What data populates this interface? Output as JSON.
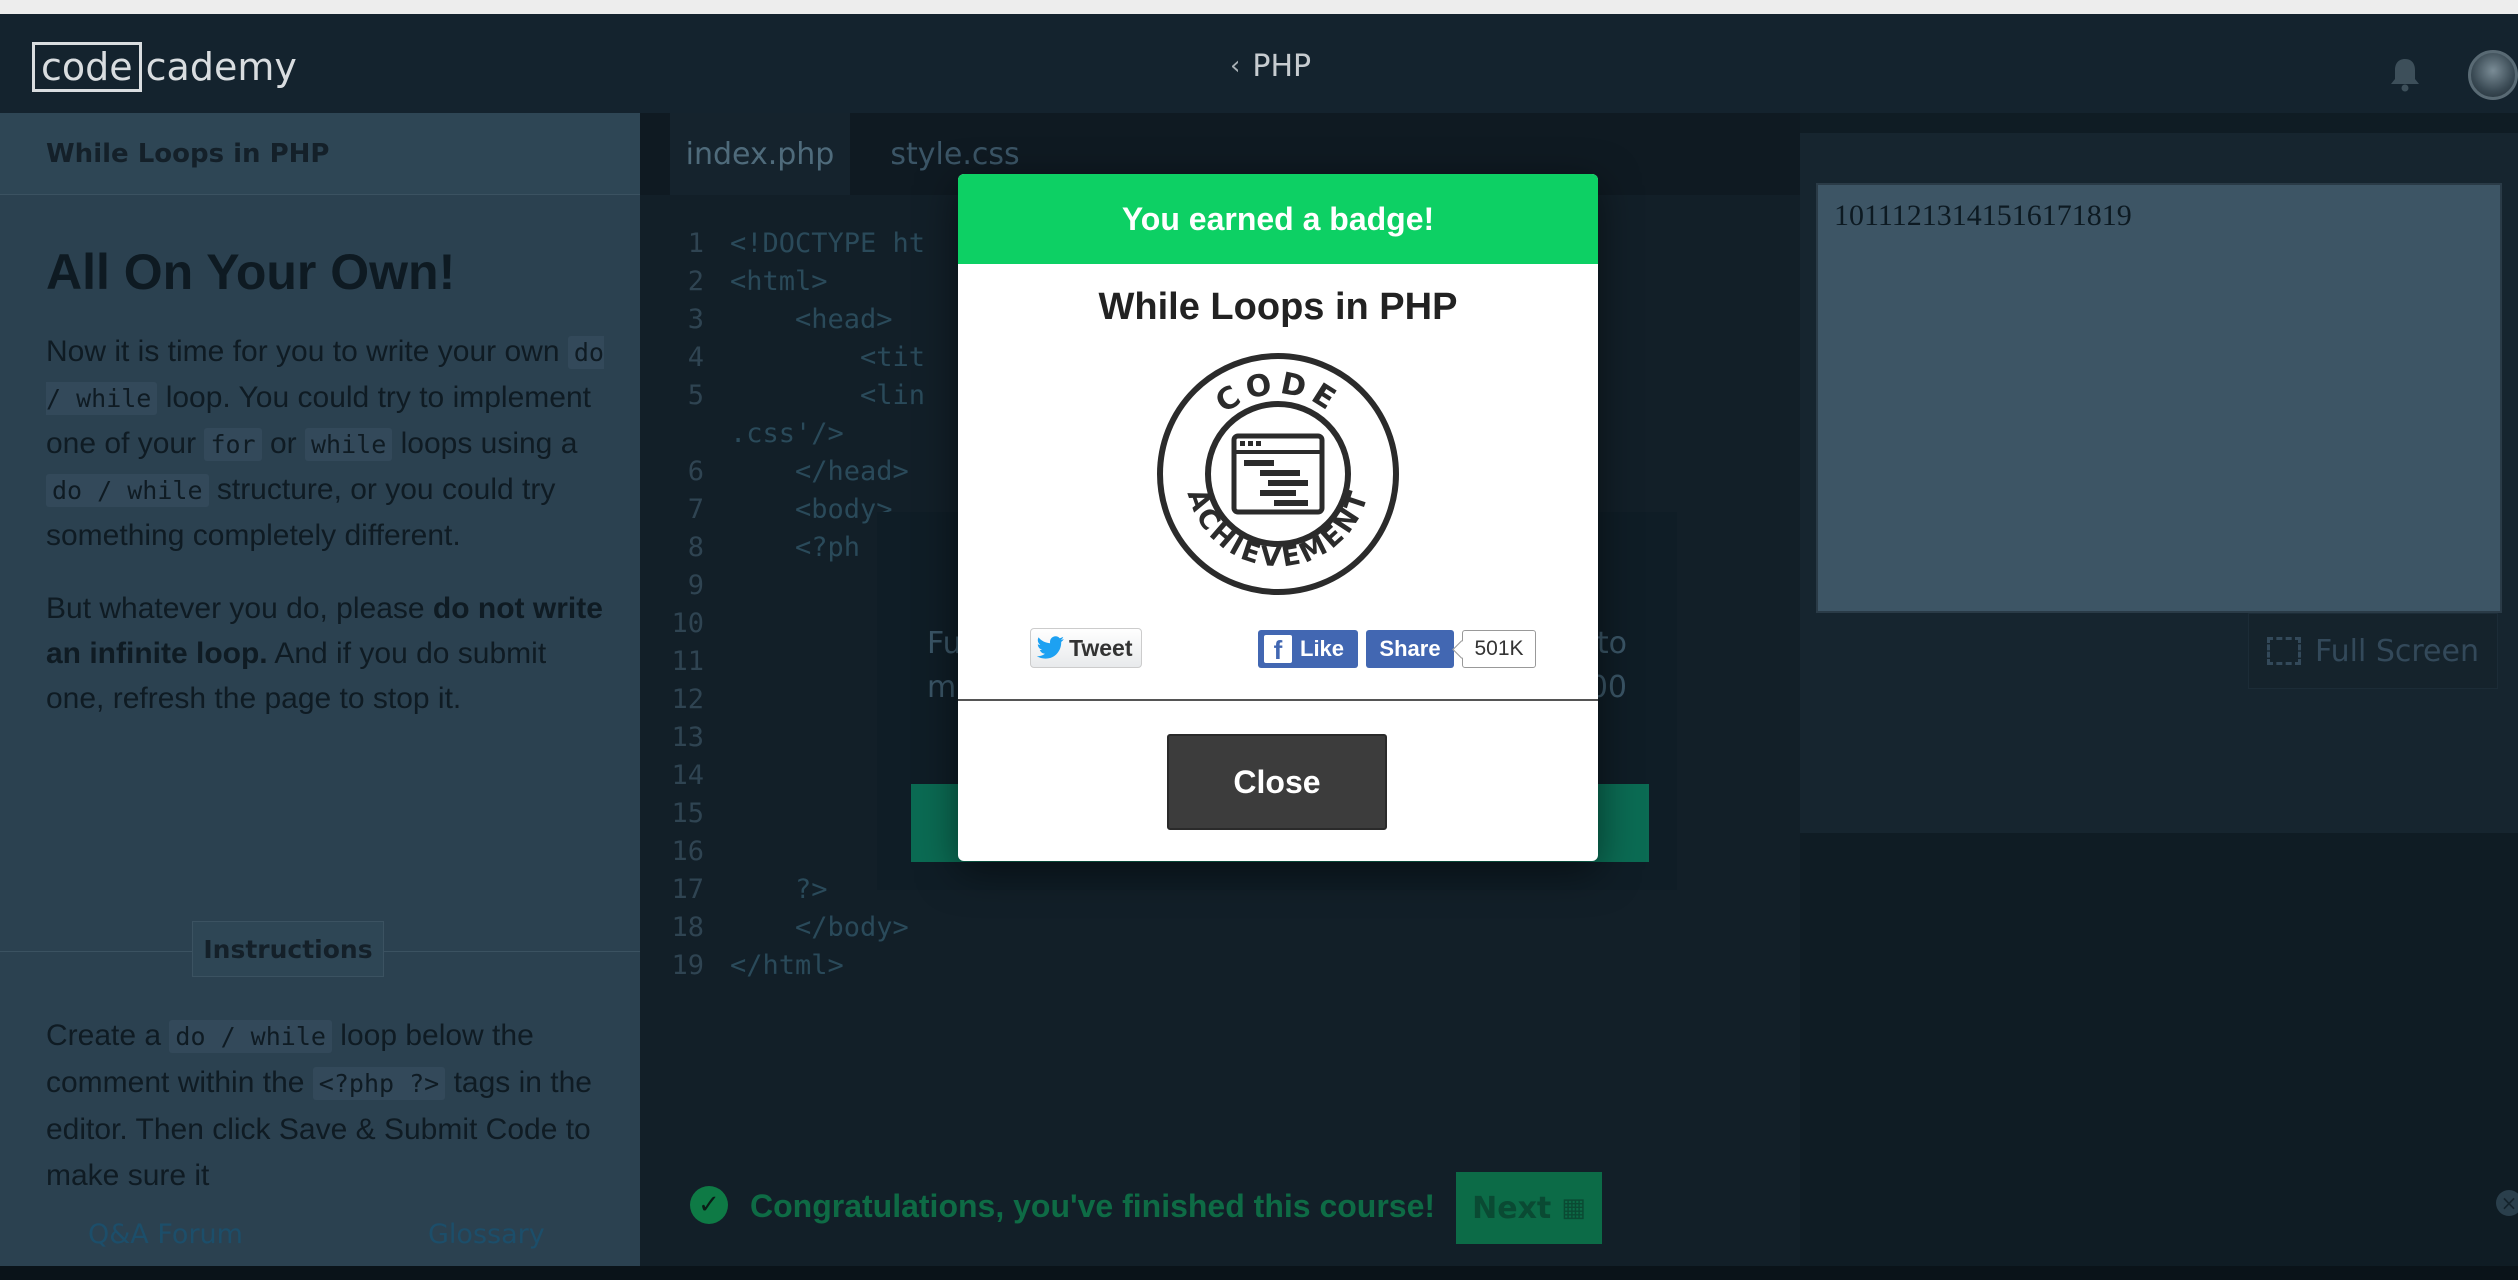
{
  "header": {
    "logo_code": "code",
    "logo_cademy": "cademy",
    "course_name": "PHP"
  },
  "left_panel": {
    "breadcrumb": "While Loops in PHP",
    "title": "All On Your Own!",
    "p1_a": "Now it is time for you to write your own",
    "p1_code1": "do / while",
    "p1_b": "loop. You could try to implement one of your",
    "p1_code2": "for",
    "p1_c": "or",
    "p1_code3": "while",
    "p1_d": "loops using a",
    "p1_code4": "do / while",
    "p1_e": "structure, or you could try something completely different.",
    "p2_a": "But whatever you do, please",
    "p2_bold": "do not write an infinite loop.",
    "p2_b": "And if you do submit one, refresh the page to stop it.",
    "instructions_tab": "Instructions",
    "instr_a": "Create a",
    "instr_code1": "do / while",
    "instr_b": "loop below the comment within the",
    "instr_code2": "<?php ?>",
    "instr_c": "tags in the editor. Then click Save & Submit Code to make sure it",
    "footer_qa": "Q&A Forum",
    "footer_glossary": "Glossary"
  },
  "editor": {
    "tabs": [
      "index.php",
      "style.css"
    ],
    "lines": [
      {
        "n": "1",
        "t": "<!DOCTYPE ht"
      },
      {
        "n": "2",
        "t": "<html>"
      },
      {
        "n": "3",
        "t": "    <head>"
      },
      {
        "n": "4",
        "t": "        <tit"
      },
      {
        "n": "5",
        "t": "        <lin                                  ='style"
      },
      {
        "n": "",
        "t": ".css'/>"
      },
      {
        "n": "6",
        "t": "    </head>"
      },
      {
        "n": "7",
        "t": "    <body>"
      },
      {
        "n": "8",
        "t": "    <?ph"
      },
      {
        "n": "9",
        "t": ""
      },
      {
        "n": "10",
        "t": ""
      },
      {
        "n": "11",
        "t": ""
      },
      {
        "n": "12",
        "t": ""
      },
      {
        "n": "13",
        "t": ""
      },
      {
        "n": "14",
        "t": ""
      },
      {
        "n": "15",
        "t": ""
      },
      {
        "n": "16",
        "t": ""
      },
      {
        "n": "17",
        "t": "    ?>"
      },
      {
        "n": "18",
        "t": "    </body>"
      },
      {
        "n": "19",
        "t": "</html>"
      }
    ],
    "back_dialog_left": "Fu\nm",
    "back_dialog_right": "to\n00"
  },
  "bottom_bar": {
    "congrats": "Congratulations, you've finished this course!",
    "next_label": "Next"
  },
  "preview": {
    "output": "10111213141516171819",
    "fullscreen_label": "Full Screen"
  },
  "modal": {
    "header": "You earned a badge!",
    "title": "While Loops in PHP",
    "badge_top_text": "CODE",
    "badge_bottom_text": "ACHIEVEMENT",
    "tweet_label": "Tweet",
    "like_label": "Like",
    "share_label": "Share",
    "share_count": "501K",
    "close_label": "Close"
  },
  "colors": {
    "badge_green": "#0dd064",
    "facebook_blue": "#4267b2",
    "close_button": "#3c3c3c"
  }
}
